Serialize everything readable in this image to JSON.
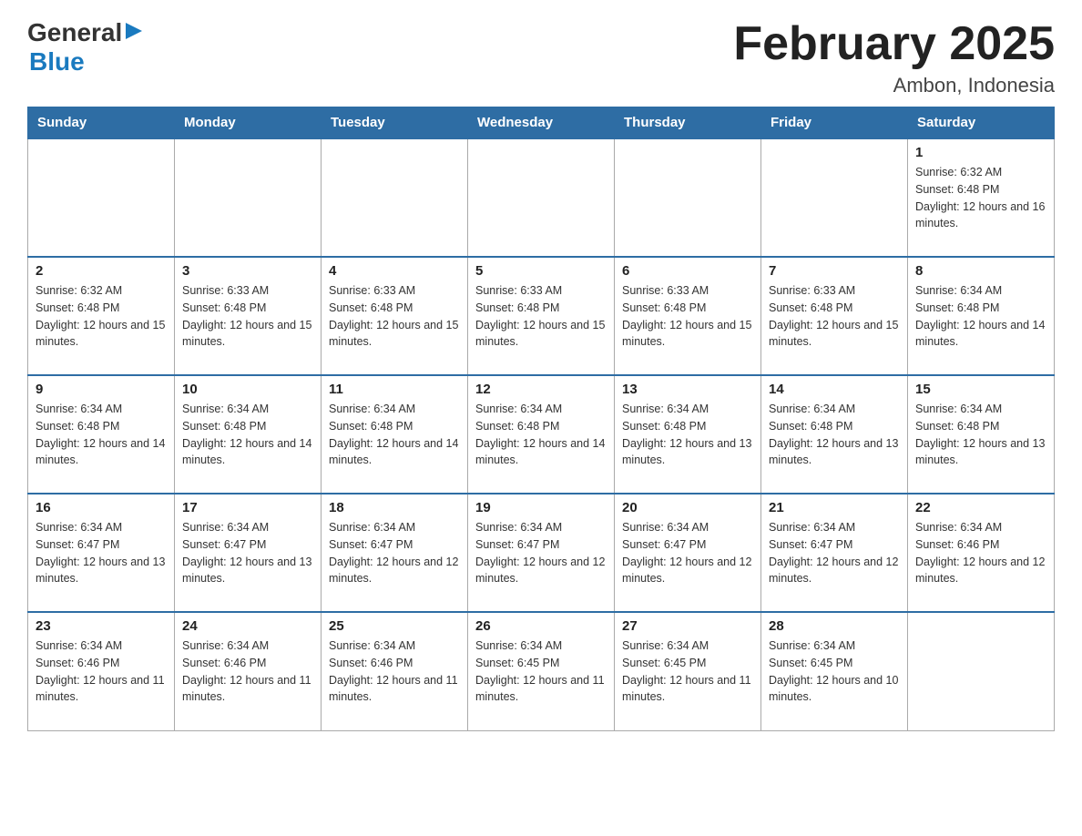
{
  "logo": {
    "general": "General",
    "blue": "Blue",
    "arrow": "▶"
  },
  "title": "February 2025",
  "location": "Ambon, Indonesia",
  "headers": [
    "Sunday",
    "Monday",
    "Tuesday",
    "Wednesday",
    "Thursday",
    "Friday",
    "Saturday"
  ],
  "weeks": [
    [
      {
        "day": "",
        "info": ""
      },
      {
        "day": "",
        "info": ""
      },
      {
        "day": "",
        "info": ""
      },
      {
        "day": "",
        "info": ""
      },
      {
        "day": "",
        "info": ""
      },
      {
        "day": "",
        "info": ""
      },
      {
        "day": "1",
        "info": "Sunrise: 6:32 AM\nSunset: 6:48 PM\nDaylight: 12 hours and 16 minutes."
      }
    ],
    [
      {
        "day": "2",
        "info": "Sunrise: 6:32 AM\nSunset: 6:48 PM\nDaylight: 12 hours and 15 minutes."
      },
      {
        "day": "3",
        "info": "Sunrise: 6:33 AM\nSunset: 6:48 PM\nDaylight: 12 hours and 15 minutes."
      },
      {
        "day": "4",
        "info": "Sunrise: 6:33 AM\nSunset: 6:48 PM\nDaylight: 12 hours and 15 minutes."
      },
      {
        "day": "5",
        "info": "Sunrise: 6:33 AM\nSunset: 6:48 PM\nDaylight: 12 hours and 15 minutes."
      },
      {
        "day": "6",
        "info": "Sunrise: 6:33 AM\nSunset: 6:48 PM\nDaylight: 12 hours and 15 minutes."
      },
      {
        "day": "7",
        "info": "Sunrise: 6:33 AM\nSunset: 6:48 PM\nDaylight: 12 hours and 15 minutes."
      },
      {
        "day": "8",
        "info": "Sunrise: 6:34 AM\nSunset: 6:48 PM\nDaylight: 12 hours and 14 minutes."
      }
    ],
    [
      {
        "day": "9",
        "info": "Sunrise: 6:34 AM\nSunset: 6:48 PM\nDaylight: 12 hours and 14 minutes."
      },
      {
        "day": "10",
        "info": "Sunrise: 6:34 AM\nSunset: 6:48 PM\nDaylight: 12 hours and 14 minutes."
      },
      {
        "day": "11",
        "info": "Sunrise: 6:34 AM\nSunset: 6:48 PM\nDaylight: 12 hours and 14 minutes."
      },
      {
        "day": "12",
        "info": "Sunrise: 6:34 AM\nSunset: 6:48 PM\nDaylight: 12 hours and 14 minutes."
      },
      {
        "day": "13",
        "info": "Sunrise: 6:34 AM\nSunset: 6:48 PM\nDaylight: 12 hours and 13 minutes."
      },
      {
        "day": "14",
        "info": "Sunrise: 6:34 AM\nSunset: 6:48 PM\nDaylight: 12 hours and 13 minutes."
      },
      {
        "day": "15",
        "info": "Sunrise: 6:34 AM\nSunset: 6:48 PM\nDaylight: 12 hours and 13 minutes."
      }
    ],
    [
      {
        "day": "16",
        "info": "Sunrise: 6:34 AM\nSunset: 6:47 PM\nDaylight: 12 hours and 13 minutes."
      },
      {
        "day": "17",
        "info": "Sunrise: 6:34 AM\nSunset: 6:47 PM\nDaylight: 12 hours and 13 minutes."
      },
      {
        "day": "18",
        "info": "Sunrise: 6:34 AM\nSunset: 6:47 PM\nDaylight: 12 hours and 12 minutes."
      },
      {
        "day": "19",
        "info": "Sunrise: 6:34 AM\nSunset: 6:47 PM\nDaylight: 12 hours and 12 minutes."
      },
      {
        "day": "20",
        "info": "Sunrise: 6:34 AM\nSunset: 6:47 PM\nDaylight: 12 hours and 12 minutes."
      },
      {
        "day": "21",
        "info": "Sunrise: 6:34 AM\nSunset: 6:47 PM\nDaylight: 12 hours and 12 minutes."
      },
      {
        "day": "22",
        "info": "Sunrise: 6:34 AM\nSunset: 6:46 PM\nDaylight: 12 hours and 12 minutes."
      }
    ],
    [
      {
        "day": "23",
        "info": "Sunrise: 6:34 AM\nSunset: 6:46 PM\nDaylight: 12 hours and 11 minutes."
      },
      {
        "day": "24",
        "info": "Sunrise: 6:34 AM\nSunset: 6:46 PM\nDaylight: 12 hours and 11 minutes."
      },
      {
        "day": "25",
        "info": "Sunrise: 6:34 AM\nSunset: 6:46 PM\nDaylight: 12 hours and 11 minutes."
      },
      {
        "day": "26",
        "info": "Sunrise: 6:34 AM\nSunset: 6:45 PM\nDaylight: 12 hours and 11 minutes."
      },
      {
        "day": "27",
        "info": "Sunrise: 6:34 AM\nSunset: 6:45 PM\nDaylight: 12 hours and 11 minutes."
      },
      {
        "day": "28",
        "info": "Sunrise: 6:34 AM\nSunset: 6:45 PM\nDaylight: 12 hours and 10 minutes."
      },
      {
        "day": "",
        "info": ""
      }
    ]
  ]
}
